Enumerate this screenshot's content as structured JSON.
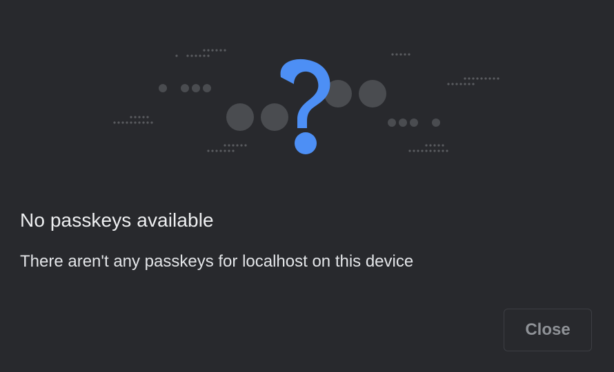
{
  "dialog": {
    "illustration": {
      "icon": "question-mark-icon",
      "accent_color": "#4d8ff5",
      "dot_color": "#4a4c50"
    },
    "title": "No passkeys available",
    "description": "There aren't any passkeys for localhost on this device",
    "close_label": "Close"
  }
}
